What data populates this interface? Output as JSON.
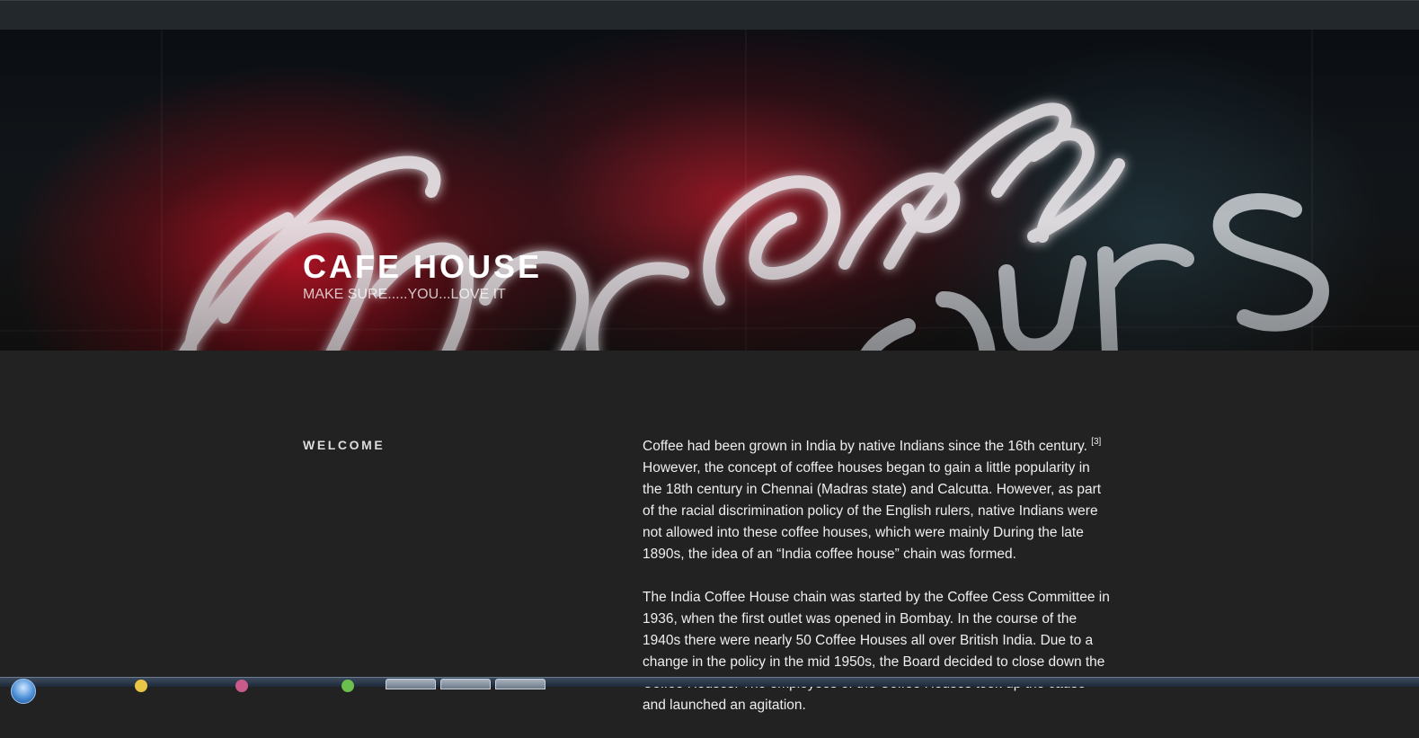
{
  "site": {
    "title": "CAFE HOUSE",
    "tagline": "MAKE SURE.....YOU...LOVE IT"
  },
  "section": {
    "heading": "WELCOME"
  },
  "article": {
    "p1_part1": "Coffee had been grown in India by native Indians since the 16th century.",
    "p1_ref": "[3]",
    "p1_part2": " However, the concept of coffee houses began to gain a little popularity in the 18th century in Chennai (Madras state) and Calcutta. However, as part of the racial discrimination policy of the English rulers, native Indians were not allowed into these coffee houses, which were mainly During the late 1890s, the idea of an “India coffee house” chain was formed.",
    "p2": "The India Coffee House chain was started by the Coffee Cess Committee in 1936, when the first outlet was opened in Bombay. In the course of the 1940s there were nearly 50 Coffee Houses all over British India. Due to a change in the policy in the mid 1950s, the Board decided to close down the Coffee Houses. The employees of the Coffee Houses took up the cause and launched an agitation."
  },
  "colors": {
    "background": "#222222",
    "top_bar": "#23282d",
    "neon_red": "#d2142a",
    "neon_white": "#e8e8ee",
    "text": "#eeeeee"
  }
}
